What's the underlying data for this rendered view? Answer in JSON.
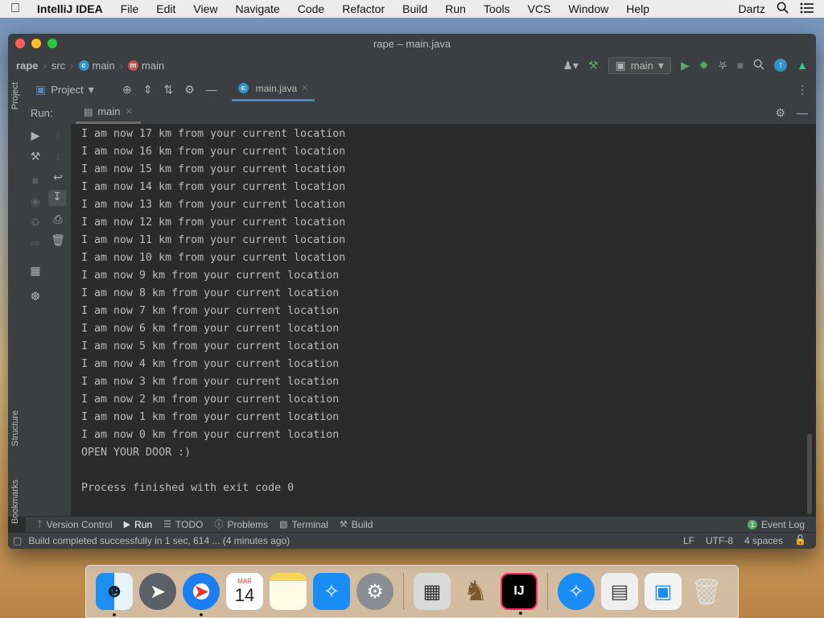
{
  "menubar": {
    "app_name": "IntelliJ IDEA",
    "items": [
      "File",
      "Edit",
      "View",
      "Navigate",
      "Code",
      "Refactor",
      "Build",
      "Run",
      "Tools",
      "VCS",
      "Window",
      "Help"
    ],
    "user": "Dartz"
  },
  "window": {
    "title": "rape – main.java"
  },
  "breadcrumb": {
    "project": "rape",
    "src": "src",
    "class": "main",
    "method": "main"
  },
  "toolbar": {
    "run_config": "main"
  },
  "project_panel": {
    "label": "Project"
  },
  "editor_tab": {
    "label": "main.java"
  },
  "run_panel": {
    "label": "Run:",
    "tab_label": "main"
  },
  "side_tabs": {
    "project": "Project",
    "structure": "Structure",
    "bookmarks": "Bookmarks"
  },
  "console_lines": [
    "I am now 17 km from your current location",
    "I am now 16 km from your current location",
    "I am now 15 km from your current location",
    "I am now 14 km from your current location",
    "I am now 13 km from your current location",
    "I am now 12 km from your current location",
    "I am now 11 km from your current location",
    "I am now 10 km from your current location",
    "I am now 9 km from your current location",
    "I am now 8 km from your current location",
    "I am now 7 km from your current location",
    "I am now 6 km from your current location",
    "I am now 5 km from your current location",
    "I am now 4 km from your current location",
    "I am now 3 km from your current location",
    "I am now 2 km from your current location",
    "I am now 1 km from your current location",
    "I am now 0 km from your current location",
    "OPEN YOUR DOOR :)",
    "",
    "Process finished with exit code 0"
  ],
  "bottom_tabs": {
    "version_control": "Version Control",
    "run": "Run",
    "todo": "TODO",
    "problems": "Problems",
    "terminal": "Terminal",
    "build": "Build",
    "event_log": "Event Log",
    "event_count": "1"
  },
  "statusbar": {
    "message": "Build completed successfully in 1 sec, 614 ... (4 minutes ago)",
    "line_sep": "LF",
    "encoding": "UTF-8",
    "indent": "4 spaces"
  },
  "dock": {
    "calendar_month": "MAR",
    "calendar_day": "14",
    "intellij_label": "IJ"
  },
  "colors": {
    "accent_blue": "#4a88c7",
    "run_green": "#59a869",
    "console_bg": "#2b2b2b",
    "panel_bg": "#3c3f41"
  }
}
